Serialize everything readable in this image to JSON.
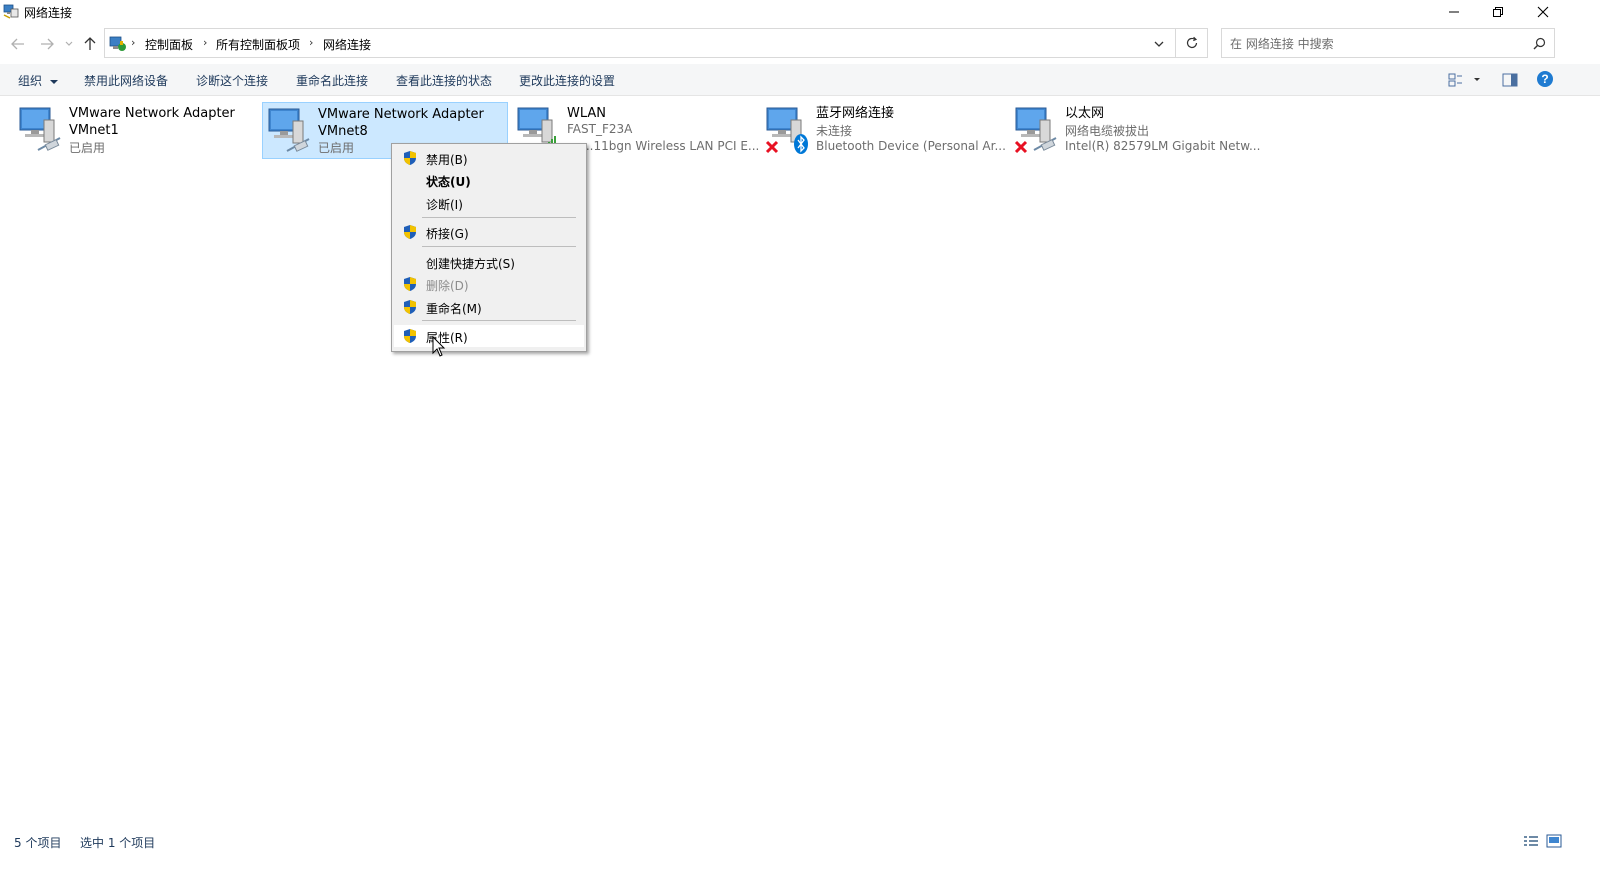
{
  "window": {
    "title": "网络连接",
    "minimize_icon": "minimize-icon",
    "restore_icon": "restore-icon",
    "close_icon": "close-icon"
  },
  "nav": {
    "breadcrumbs": [
      "控制面板",
      "所有控制面板项",
      "网络连接"
    ]
  },
  "search": {
    "placeholder": "在 网络连接 中搜索"
  },
  "toolbar": {
    "organize": "组织",
    "disable": "禁用此网络设备",
    "diagnose": "诊断这个连接",
    "rename": "重命名此连接",
    "view_status": "查看此连接的状态",
    "change_settings": "更改此连接的设置"
  },
  "connections": [
    {
      "name_line1": "VMware Network Adapter",
      "name_line2": "VMnet1",
      "status": "已启用",
      "device": ""
    },
    {
      "name_line1": "VMware Network Adapter",
      "name_line2": "VMnet8",
      "status": "已启用",
      "device": "",
      "selected": true
    },
    {
      "name_line1": "WLAN",
      "name_line2": "",
      "status": "FAST_F23A",
      "device": "...11bgn Wireless LAN PCI E..."
    },
    {
      "name_line1": "蓝牙网络连接",
      "name_line2": "",
      "status": "未连接",
      "device": "Bluetooth Device (Personal Ar..."
    },
    {
      "name_line1": "以太网",
      "name_line2": "",
      "status": "网络电缆被拔出",
      "device": "Intel(R) 82579LM Gigabit Netw..."
    }
  ],
  "context_menu": {
    "items": [
      {
        "label": "禁用(B)",
        "shield": true
      },
      {
        "label": "状态(U)",
        "bold": true
      },
      {
        "label": "诊断(I)"
      },
      {
        "label": "桥接(G)",
        "shield": true
      },
      {
        "label": "创建快捷方式(S)"
      },
      {
        "label": "删除(D)",
        "shield": true,
        "disabled": true
      },
      {
        "label": "重命名(M)",
        "shield": true
      },
      {
        "label": "属性(R)",
        "shield": true,
        "hover": true
      }
    ]
  },
  "statusbar": {
    "count": "5 个项目",
    "selected": "选中 1 个项目"
  },
  "colors": {
    "selection_bg": "#cce8ff",
    "selection_border": "#99d1ff",
    "link_text": "#1e395b",
    "error_red": "#e81123",
    "bluetooth_blue": "#0078d7"
  }
}
